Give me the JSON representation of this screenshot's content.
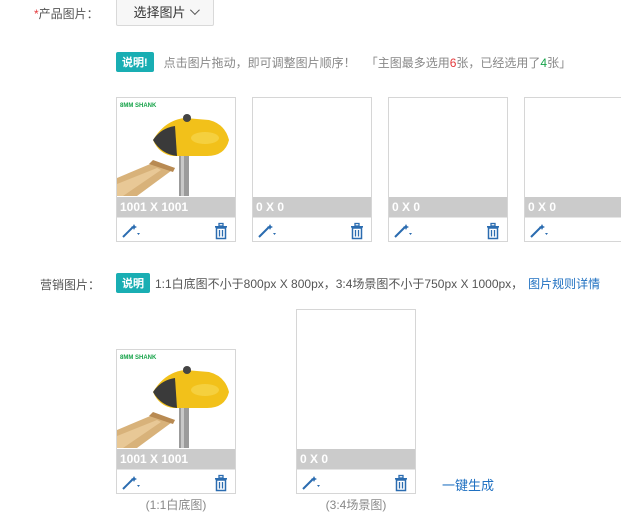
{
  "product_images": {
    "required_mark": "*",
    "label": "产品图片：",
    "select_button": "选择图片",
    "notice_badge": "说明!",
    "notice_text_1": "点击图片拖动，即可调整图片顺序！",
    "notice_text_2_prefix": "「主图最多选用",
    "max_count": "6",
    "notice_text_2_mid": "张，已经选用了",
    "used_count": "4",
    "notice_text_2_suffix": "张」",
    "thumbnails": [
      {
        "dimension": "1001 X 1001",
        "has_image": true,
        "image_tag": "8MM SHANK"
      },
      {
        "dimension": "0 X 0",
        "has_image": false
      },
      {
        "dimension": "0 X 0",
        "has_image": false
      },
      {
        "dimension": "0 X 0",
        "has_image": false
      }
    ]
  },
  "marketing_images": {
    "label": "营销图片：",
    "notice_badge": "说明",
    "notice_text": "1:1白底图不小于800px X 800px，3:4场景图不小于750px X 1000px，",
    "rules_link": "图片规则详情",
    "thumbnails": [
      {
        "dimension": "1001 X 1001",
        "has_image": true,
        "image_tag": "8MM SHANK",
        "caption": "(1:1白底图)"
      },
      {
        "dimension": "0 X 0",
        "has_image": false,
        "caption": "(3:4场景图)"
      }
    ],
    "generate_link": "一键生成"
  },
  "colors": {
    "accent_teal": "#19aeb3",
    "link_blue": "#1f70c1",
    "required_red": "#e4393c",
    "count_green": "#16a34a"
  },
  "icons": [
    "chevron-down-icon",
    "magic-wand-icon",
    "trash-icon"
  ]
}
